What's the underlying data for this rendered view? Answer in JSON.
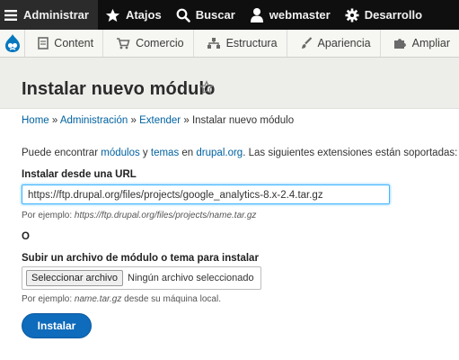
{
  "toolbar": {
    "items": [
      {
        "label": "Administrar",
        "icon": "hamburger-icon"
      },
      {
        "label": "Atajos",
        "icon": "star-icon"
      },
      {
        "label": "Buscar",
        "icon": "search-icon"
      },
      {
        "label": "webmaster",
        "icon": "user-icon"
      },
      {
        "label": "Desarrollo",
        "icon": "gear-icon"
      }
    ]
  },
  "tray": {
    "logo_icon": "drupal-drop-icon",
    "items": [
      {
        "label": "Content",
        "icon": "content-icon"
      },
      {
        "label": "Comercio",
        "icon": "cart-icon"
      },
      {
        "label": "Estructura",
        "icon": "structure-icon"
      },
      {
        "label": "Apariencia",
        "icon": "brush-icon"
      },
      {
        "label": "Ampliar",
        "icon": "puzzle-icon"
      }
    ]
  },
  "page": {
    "title": "Instalar nuevo módulo",
    "title_icon": "star-outline-icon"
  },
  "breadcrumb": {
    "items": [
      "Home",
      "Administración",
      "Extender"
    ],
    "separator": "»",
    "current": "Instalar nuevo módulo"
  },
  "intro": {
    "part1": "Puede encontrar",
    "link1": "módulos",
    "part2": "y",
    "link2": "temas",
    "part3": "en",
    "link3": "drupal.org",
    "part4": ". Las siguientes extensiones están soportadas:"
  },
  "form": {
    "url_label": "Instalar desde una URL",
    "url_value": "https://ftp.drupal.org/files/projects/google_analytics-8.x-2.4.tar.gz",
    "url_hint_prefix": "Por ejemplo:",
    "url_hint_example": "https://ftp.drupal.org/files/projects/name.tar.gz",
    "or_label": "O",
    "upload_label": "Subir un archivo de módulo o tema para instalar",
    "file_button": "Seleccionar archivo",
    "file_status": "Ningún archivo seleccionado",
    "upload_hint_prefix": "Por ejemplo:",
    "upload_hint_example": "name.tar.gz",
    "upload_hint_suffix": "desde su máquina local.",
    "submit_label": "Instalar"
  },
  "colors": {
    "toolbar_bg": "#0f0f0f",
    "link": "#0062a0",
    "primary_button": "#0f6bbb",
    "focus_border": "#40b6ff"
  }
}
